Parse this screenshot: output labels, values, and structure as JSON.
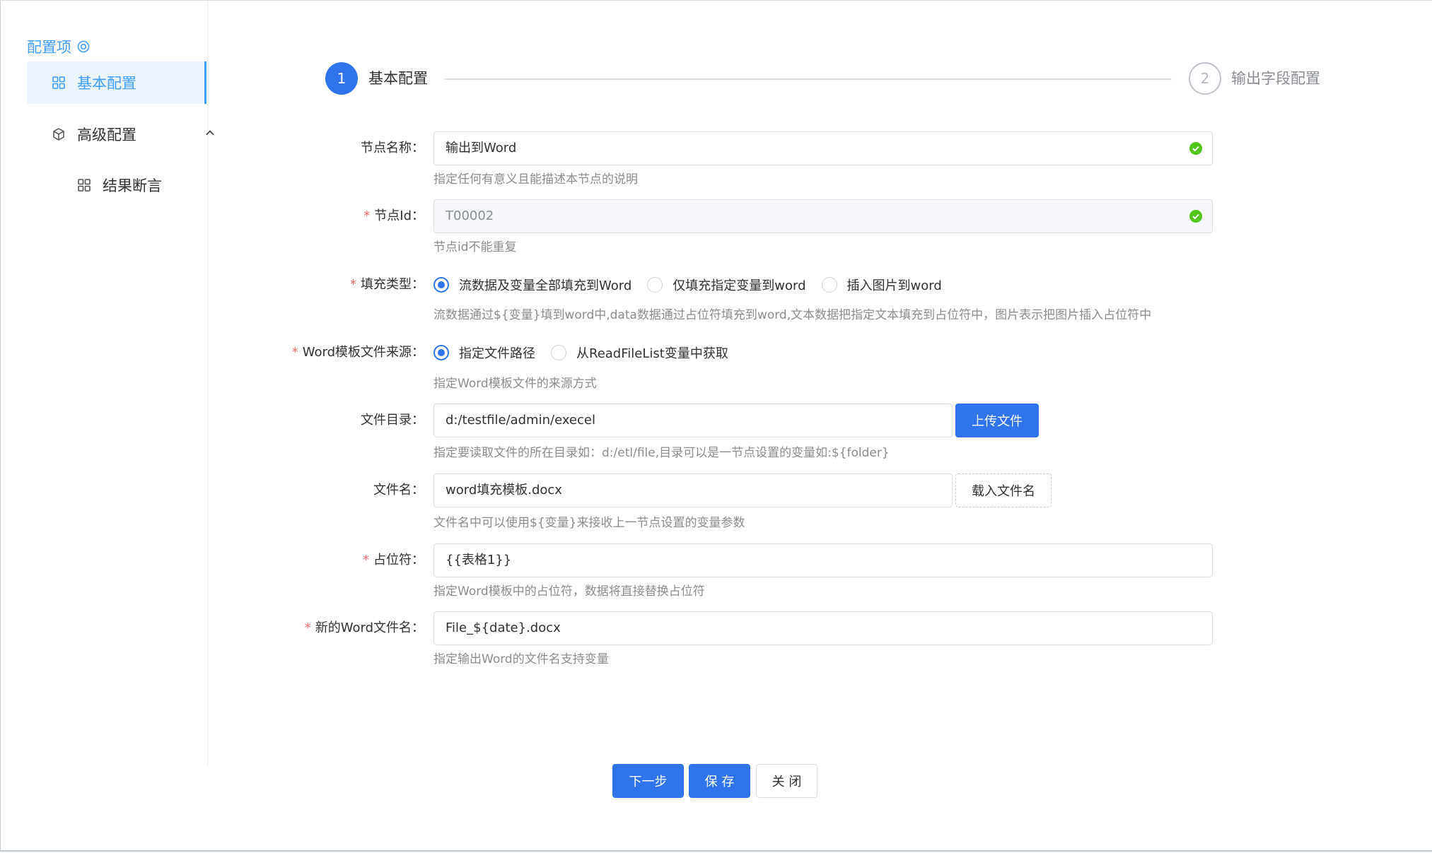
{
  "sidebar": {
    "title": "配置项",
    "title_icon": "target-icon",
    "items": [
      {
        "label": "基本配置",
        "icon": "grid-icon",
        "active": true
      },
      {
        "label": "高级配置",
        "icon": "cube-icon",
        "expanded": true
      },
      {
        "label": "结果断言",
        "icon": "grid-icon"
      }
    ]
  },
  "steps": [
    {
      "number": "1",
      "label": "基本配置",
      "active": true
    },
    {
      "number": "2",
      "label": "输出字段配置",
      "active": false
    }
  ],
  "form": {
    "node_name": {
      "label": "节点名称：",
      "value": "输出到Word",
      "hint": "指定任何有意义且能描述本节点的说明"
    },
    "node_id": {
      "label": "节点Id：",
      "value": "T00002",
      "hint": "节点id不能重复"
    },
    "fill_type": {
      "label": "填充类型：",
      "options": [
        "流数据及变量全部填充到Word",
        "仅填充指定变量到word",
        "插入图片到word"
      ],
      "selected": 0,
      "hint": "流数据通过${变量}填到word中,data数据通过占位符填充到word,文本数据把指定文本填充到占位符中，图片表示把图片插入占位符中"
    },
    "template_source": {
      "label": "Word模板文件来源：",
      "options": [
        "指定文件路径",
        "从ReadFileList变量中获取"
      ],
      "selected": 0,
      "hint": "指定Word模板文件的来源方式"
    },
    "file_dir": {
      "label": "文件目录：",
      "value": "d:/testfile/admin/execel",
      "button": "上传文件",
      "hint": "指定要读取文件的所在目录如：d:/etl/file,目录可以是一节点设置的变量如:${folder}"
    },
    "file_name": {
      "label": "文件名：",
      "value": "word填充模板.docx",
      "button": "载入文件名",
      "hint": "文件名中可以使用${变量}来接收上一节点设置的变量参数"
    },
    "placeholder": {
      "label": "占位符：",
      "value": "{{表格1}}",
      "hint": "指定Word模板中的占位符，数据将直接替换占位符"
    },
    "new_file_name": {
      "label": "新的Word文件名：",
      "value": "File_${date}.docx",
      "hint": "指定输出Word的文件名支持变量"
    }
  },
  "footer": {
    "next": "下一步",
    "save": "保 存",
    "close": "关 闭"
  },
  "colors": {
    "primary": "#2f74ed",
    "sidebar_active": "#409eff",
    "required": "#f56c6c",
    "success": "#52c41a"
  }
}
